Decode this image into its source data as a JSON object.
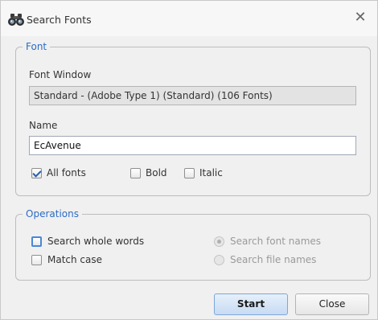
{
  "window": {
    "title": "Search Fonts",
    "close_glyph": "✕",
    "icon": "binoculars-icon"
  },
  "font_group": {
    "legend": "Font",
    "font_window_label": "Font Window",
    "font_window_value": "Standard - (Adobe Type 1) (Standard) (106 Fonts)",
    "name_label": "Name",
    "name_value": "EcAvenue",
    "all_fonts": {
      "label": "All fonts",
      "checked": true
    },
    "bold": {
      "label": "Bold",
      "checked": false
    },
    "italic": {
      "label": "Italic",
      "checked": false
    }
  },
  "operations_group": {
    "legend": "Operations",
    "search_whole_words": {
      "label": "Search whole words",
      "checked": false
    },
    "match_case": {
      "label": "Match case",
      "checked": false
    },
    "search_font_names": {
      "label": "Search font names",
      "selected": true,
      "enabled": false
    },
    "search_file_names": {
      "label": "Search file names",
      "selected": false,
      "enabled": false
    }
  },
  "buttons": {
    "start": "Start",
    "close": "Close"
  },
  "colors": {
    "legend_blue": "#2c6cc4",
    "start_button_border": "#7fa6d9"
  }
}
